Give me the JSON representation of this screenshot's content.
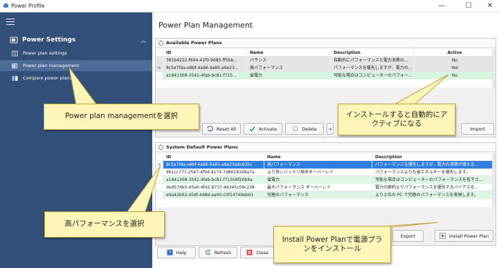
{
  "window": {
    "title": "Power Profile",
    "controls": {
      "minimize": "—",
      "maximize": "☐",
      "close": "✕"
    }
  },
  "sidebar": {
    "header": "Power Settings",
    "items": [
      {
        "label": "Power plan settings"
      },
      {
        "label": "Power plan management"
      },
      {
        "label": "Compare power plans"
      }
    ]
  },
  "main": {
    "title": "Power Plan Management",
    "available": {
      "heading": "Available Power Plans",
      "columns": [
        "ID",
        "Name",
        "Description",
        "Active"
      ],
      "rows": [
        {
          "id": "381b4222-f694-41f0-9685-ff5bb...",
          "name": "バランス",
          "desc": "自動的にパフォーマンスと電力消費の...",
          "active": "No"
        },
        {
          "id": "8c5e7fda-e8bf-4a96-9a85-a6e23...",
          "name": "高パフォーマンス",
          "desc": "パフォーマンスを優先しますが、電力の...",
          "active": "Yes"
        },
        {
          "id": "a1841308-3541-4fab-bc81-f715...",
          "name": "省電力",
          "desc": "可能な場合はコンピューターのパフォー...",
          "active": "No"
        }
      ],
      "buttons": {
        "reset_all": "Reset All",
        "activate": "Activate",
        "delete": "Delete",
        "import": "Import"
      }
    },
    "defaults": {
      "heading": "System Default Power Plans",
      "columns": [
        "ID",
        "Name",
        "Description"
      ],
      "rows": [
        {
          "id": "8c5e7fda-e8bf-4a96-9a85-a6e23a8c635c",
          "name": "高パフォーマンス",
          "desc": "パフォーマンスを優先しますが、電力の消費が増える..."
        },
        {
          "id": "961cc777-2547-4f9d-8174-7d86181b8a7a",
          "name": "より良いバッテリ寿命オーバーレイ",
          "desc": "パフォーマンスよりも省エネルギーを優先します。"
        },
        {
          "id": "a1841308-3541-4fab-bc81-f71556f20b4a",
          "name": "省電力",
          "desc": "可能な場合はコンピューターのパフォーマンスを低下さ..."
        },
        {
          "id": "ded574b5-45a0-4f42-8737-46345c09c238",
          "name": "最大パフォーマンス オーバーレイ",
          "desc": "電力の節約よりパフォーマンスを優先するバイアスを..."
        },
        {
          "id": "e9a42b02-d5df-448d-aa00-03f14749eb61",
          "name": "究極のパフォーマンス",
          "desc": "より上位の PC で究極のパフォーマンスを実現します。"
        }
      ],
      "buttons": {
        "export": "Export",
        "install": "Install Power Plan"
      }
    },
    "footer": {
      "help": "Help",
      "refresh": "Refresh",
      "close": "Close"
    }
  },
  "callouts": {
    "select_management": "Power plan managementを選択",
    "auto_active": "インストールすると自動的にアクティブになる",
    "select_high_perf": "高パフォーマンスを選択",
    "install_plan": "Install Power Planで電源プランをインストール"
  },
  "colors": {
    "sidebar_bg": "#33507a",
    "sidebar_active": "#4d6c97",
    "selection": "#2f7de1",
    "green_shade": "#d8f5e1",
    "callout_bg": "#fdf6b8"
  }
}
